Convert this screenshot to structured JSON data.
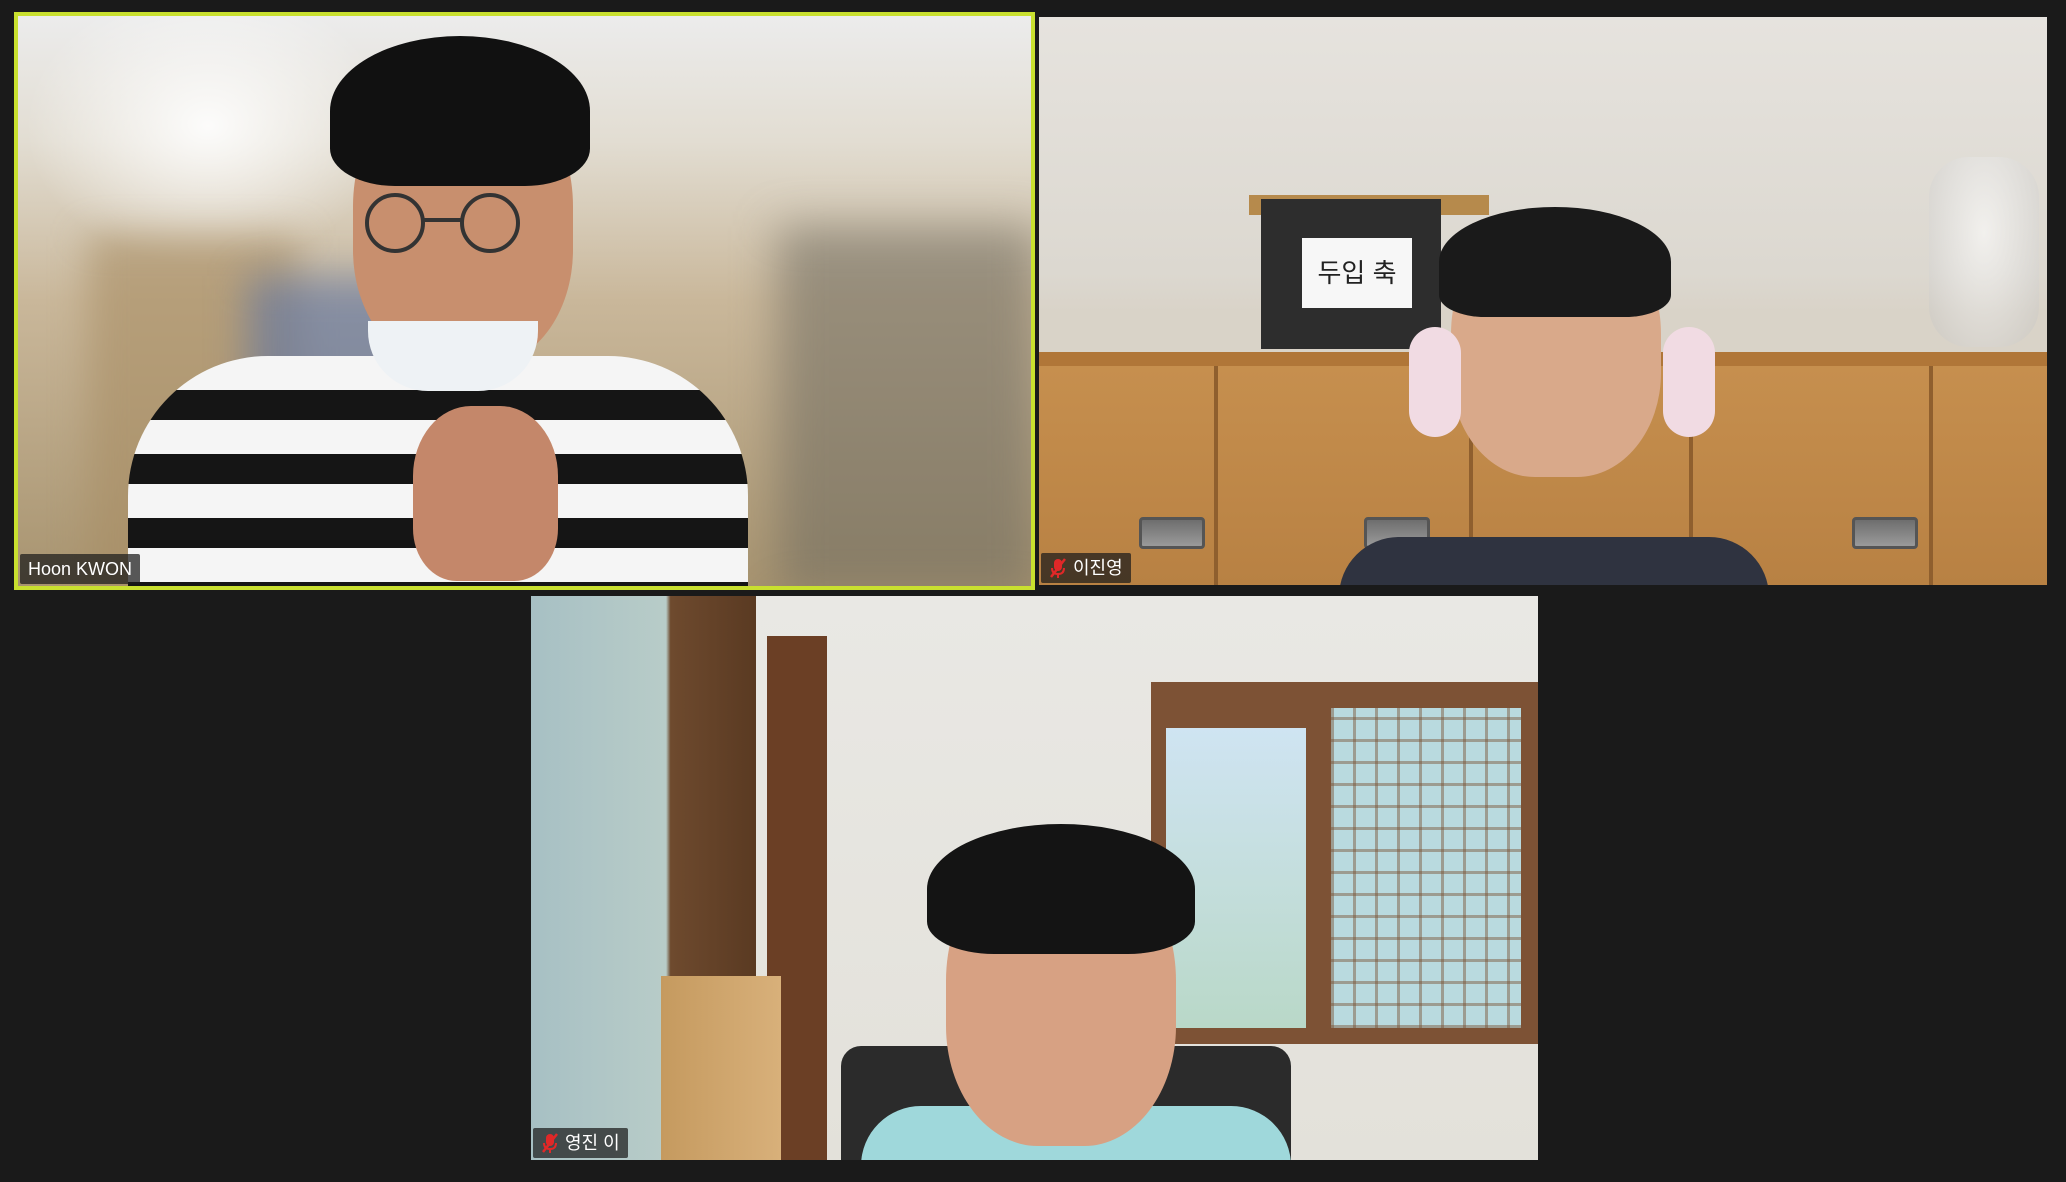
{
  "participants": [
    {
      "name": "Hoon KWON",
      "muted": false,
      "active_speaker": true
    },
    {
      "name": "이진영",
      "muted": true,
      "active_speaker": false
    },
    {
      "name": "영진 이",
      "muted": true,
      "active_speaker": false
    }
  ],
  "scene_text": {
    "cabinet_sign": "두입 축"
  },
  "colors": {
    "background": "#1a1a1a",
    "active_border": "#c9e02f",
    "mute_icon": "#e02828",
    "name_tag_text": "#ffffff"
  }
}
